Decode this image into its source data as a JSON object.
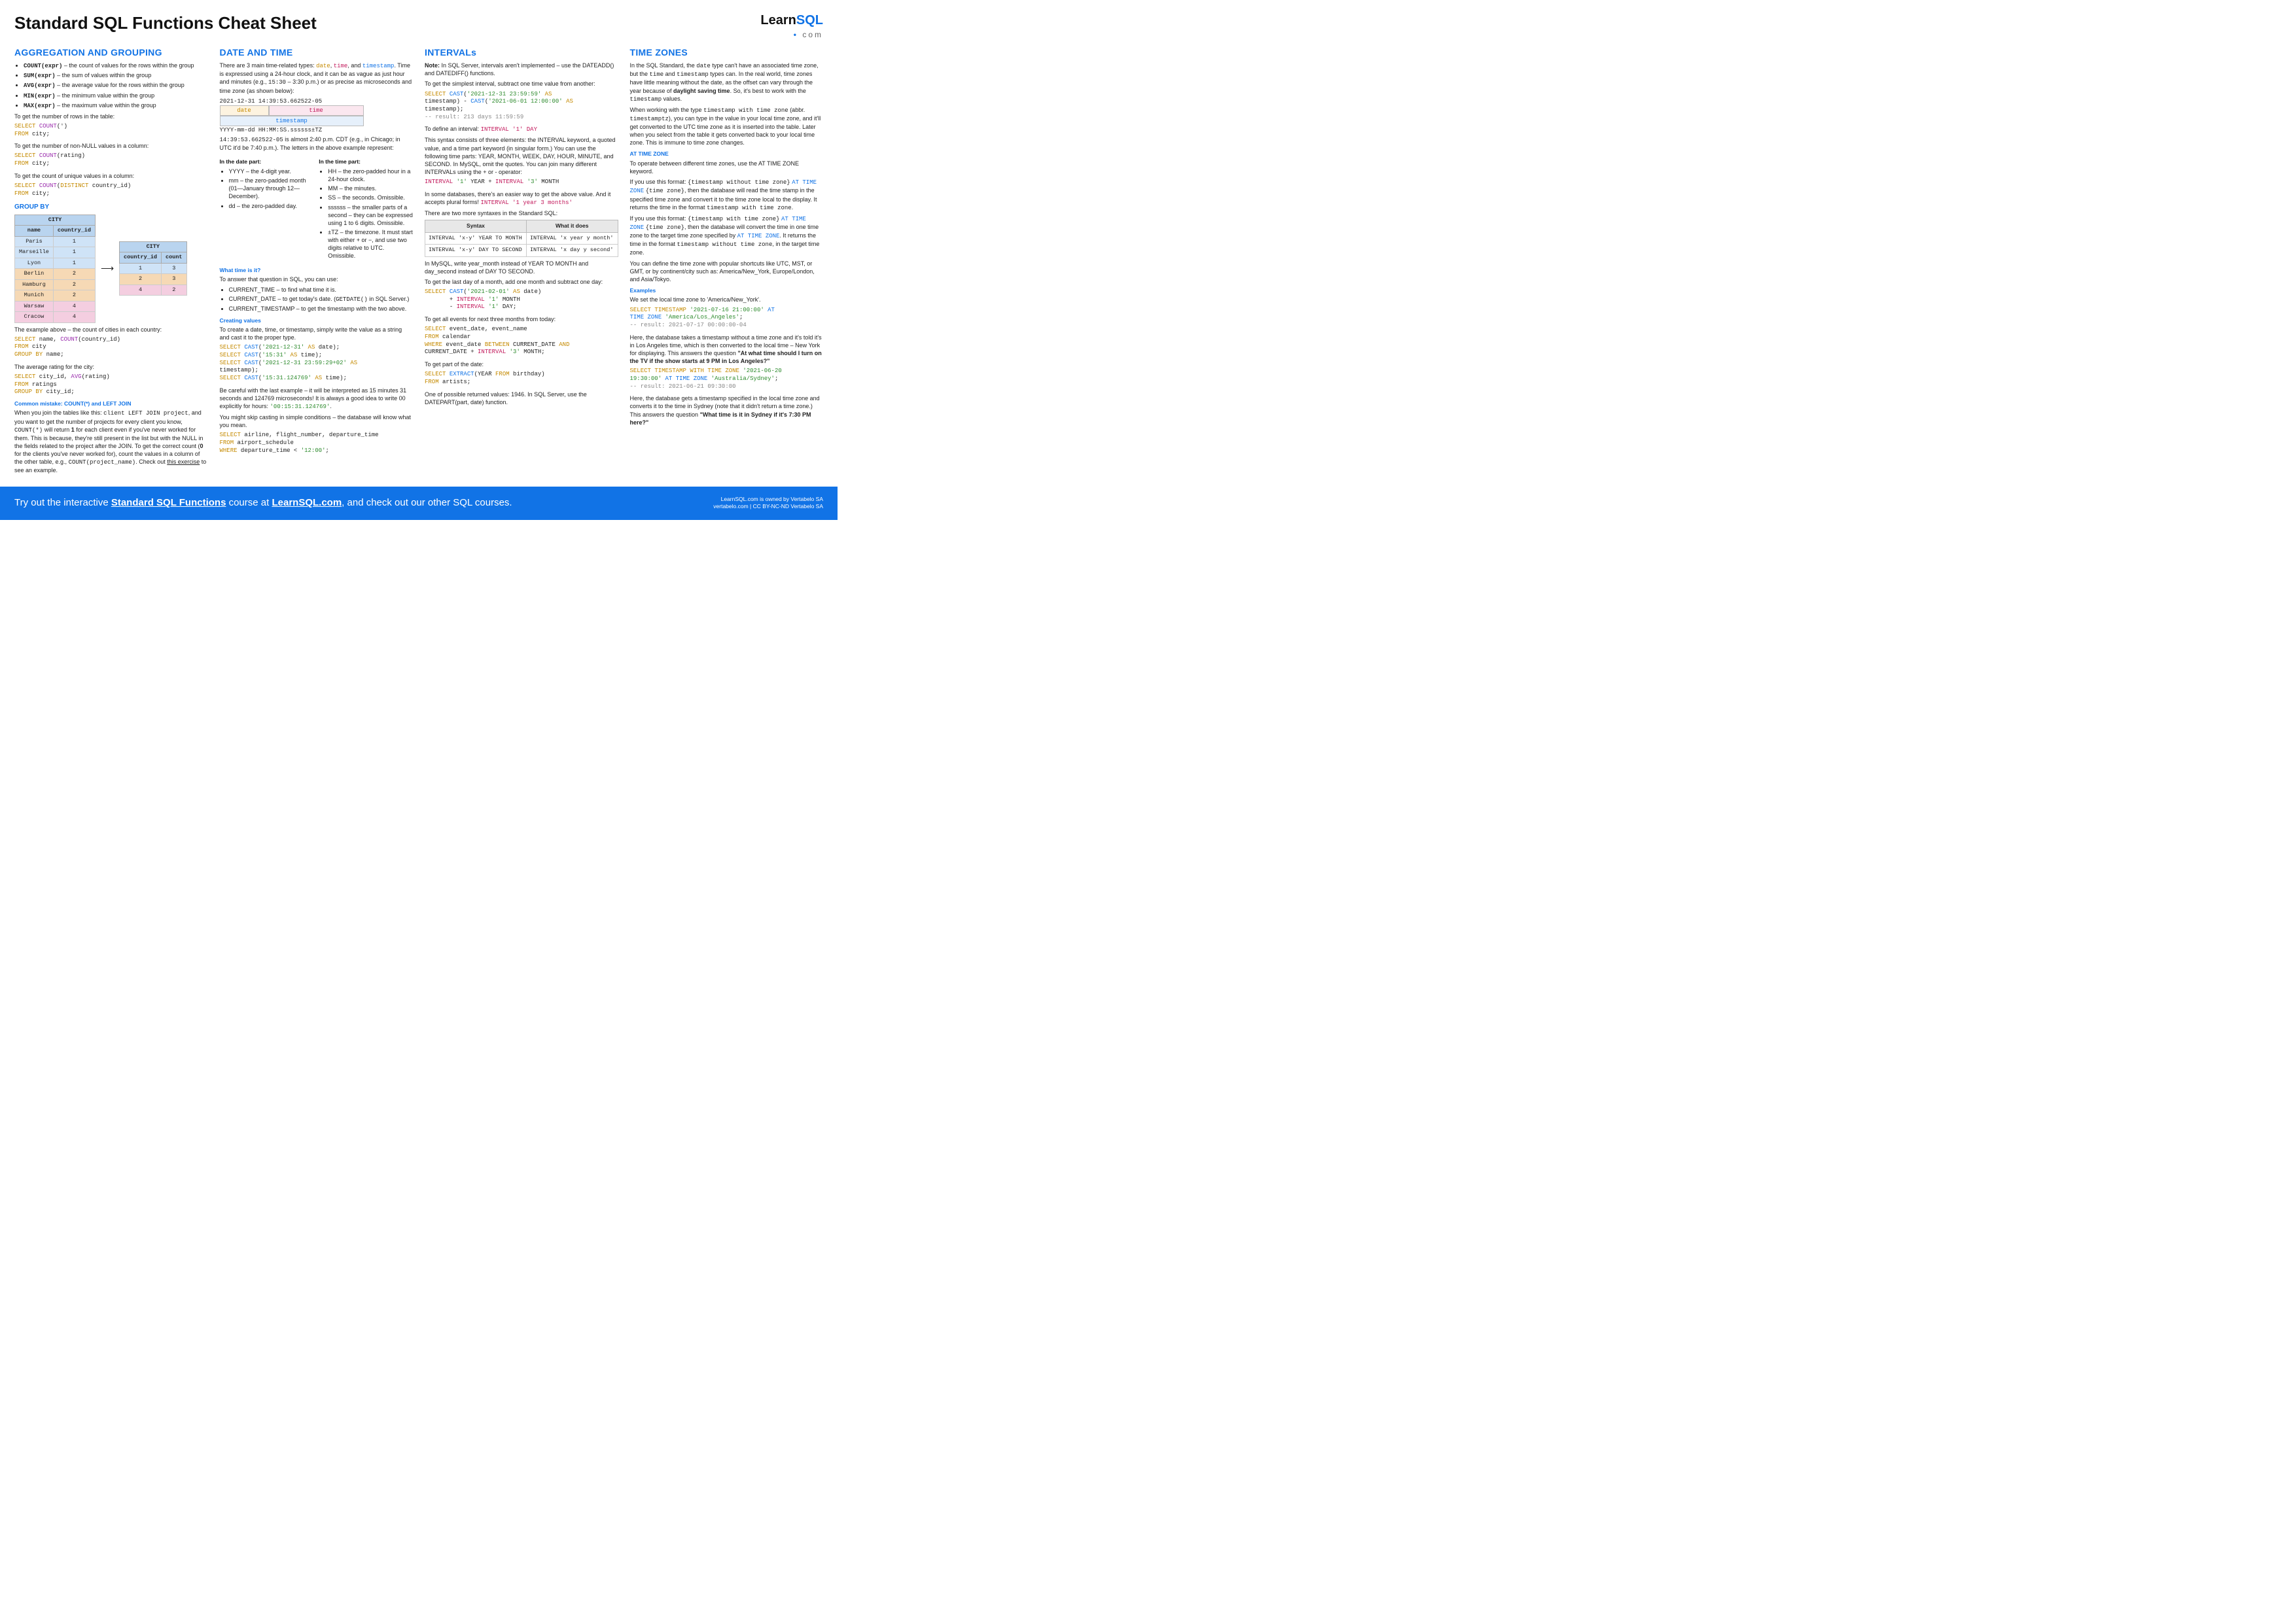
{
  "title": "Standard SQL Functions Cheat Sheet",
  "logo": {
    "learn": "Learn",
    "sql": "SQL",
    "com": "com"
  },
  "col1": {
    "h_agg": "AGGREGATION AND GROUPING",
    "agg_items": {
      "count": "COUNT(expr)",
      "count_d": " – the count of values for the rows within the group",
      "sum": "SUM(expr)",
      "sum_d": " – the sum of values within the group",
      "avg": "AVG(expr)",
      "avg_d": " – the average value for the rows within the group",
      "min": "MIN(expr)",
      "min_d": " – the minimum value within the group",
      "max": "MAX(expr)",
      "max_d": " – the maximum value within the group"
    },
    "p1": "To get the number of rows in the table:",
    "p2": "To get the number of non-NULL values in a column:",
    "p3": "To get the count of unique values in a column:",
    "h_group": "GROUP BY",
    "city_hdr": "CITY",
    "city_cols": {
      "name": "name",
      "cid": "country_id",
      "count": "count"
    },
    "city_rows": [
      {
        "n": "Paris",
        "c": "1"
      },
      {
        "n": "Marseille",
        "c": "1"
      },
      {
        "n": "Lyon",
        "c": "1"
      },
      {
        "n": "Berlin",
        "c": "2"
      },
      {
        "n": "Hamburg",
        "c": "2"
      },
      {
        "n": "Munich",
        "c": "2"
      },
      {
        "n": "Warsaw",
        "c": "4"
      },
      {
        "n": "Cracow",
        "c": "4"
      }
    ],
    "city_agg": [
      {
        "c": "1",
        "k": "3"
      },
      {
        "c": "2",
        "k": "3"
      },
      {
        "c": "4",
        "k": "2"
      }
    ],
    "p4": "The example above – the count of cities in each country:",
    "p5": "The average rating for the city:",
    "h_mistake": "Common mistake: COUNT(*) and LEFT JOIN",
    "mistake_1": "When you join the tables like this: ",
    "mistake_2": ", and you want to get the number of projects for every client you know, ",
    "mistake_3": " will return ",
    "mistake_4": " for each client even if you've never worked for them. This is because, they're still present in the list but with the NULL in the fields related to the project after the JOIN. To get the correct count (",
    "mistake_5": " for the clients you've never worked for), count the values in a column of the other table, e.g., ",
    "mistake_6": ". Check out ",
    "mistake_link": "this exercise",
    "mistake_7": " to see an example."
  },
  "col2": {
    "h_dt": "DATE AND TIME",
    "intro_1": "There are 3 main time-related types: ",
    "intro_2": ". Time is expressed using a 24-hour clock, and it can be as vague as just hour and minutes (e.g., ",
    "intro_3": " – 3:30 p.m.) or as precise as microseconds and time zone (as shown below):",
    "ts_sample": "2021-12-31 14:39:53.662522-05",
    "ts_fmt": "YYYY-mm-dd HH:MM:SS.ssssss±TZ",
    "ts_date_lbl": "date",
    "ts_time_lbl": "time",
    "ts_full_lbl": "timestamp",
    "cdt_1": "14:39:53.662522-05",
    "cdt_2": " is almost 2:40 p.m. CDT (e.g., in Chicago; in UTC it'd be 7:40 p.m.). The letters in the above example represent:",
    "h_datepart": "In the date part:",
    "h_timepart": "In the time part:",
    "dp": {
      "y": "YYYY – the 4-digit year.",
      "m": "mm – the zero-padded month (01—January through 12—December).",
      "d": "dd – the zero-padded day."
    },
    "tp": {
      "h": "HH – the zero-padded hour in a 24-hour clock.",
      "m": "MM – the minutes.",
      "s": "SS – the seconds. Omissible.",
      "ss": "ssssss – the smaller parts of a second – they can be expressed using 1 to 6 digits. Omissible.",
      "tz": "±TZ – the timezone. It must start with either + or −, and use two digits relative to UTC. Omissible."
    },
    "h_what": "What time is it?",
    "what_p": "To answer that question in SQL, you can use:",
    "what_li": {
      "ct": "CURRENT_TIME – to find what time it is.",
      "cd_1": "CURRENT_DATE – to get today's date. (",
      "cd_2": " in SQL Server.)",
      "cts": "CURRENT_TIMESTAMP – to get the timestamp with the two above."
    },
    "h_create": "Creating values",
    "create_p": "To create a date, time, or timestamp, simply write the value as a string and cast it to the proper type.",
    "create_warn_1": "Be careful with the last example – it will be interpreted as 15 minutes 31 seconds and 124769 microseconds! It is always a good idea to write 00 explicitly for hours: ",
    "create_warn_2": ".",
    "skip_p": "You might skip casting in simple conditions – the database will know what you mean."
  },
  "col3": {
    "h_int": "INTERVALs",
    "note": "Note:",
    "note_t": " In SQL Server, intervals aren't implemented – use the DATEADD() and DATEDIFF() functions.",
    "p1": "To get the simplest interval, subtract one time value from another:",
    "res1": "-- result: 213 days 11:59:59",
    "def_1": "To define an interval:  ",
    "def_2": "This syntax consists of three elements: the INTERVAL keyword, a quoted value, and a time part keyword (in singular form.) You can use the following time parts: YEAR, MONTH, WEEK, DAY, HOUR, MINUTE, and SECOND. In MySQL, omit the quotes. You can join many different INTERVALs using the + or - operator:",
    "easy_1": "In some databases, there's an easier way to get the above value. And it accepts plural forms! ",
    "easy_2": "There are two more syntaxes in the Standard SQL:",
    "tbl": {
      "h1": "Syntax",
      "h2": "What it does",
      "r1a": "INTERVAL 'x-y' YEAR TO MONTH",
      "r1b": "INTERVAL 'x year y month'",
      "r2a": "INTERVAL 'x-y' DAY TO SECOND",
      "r2b": "INTERVAL 'x day y second'"
    },
    "mysql_p": "In MySQL, write year_month instead of YEAR TO MONTH and day_second instead of DAY TO SECOND.",
    "last_p": "To get the last day of a month, add one month and subtract one day:",
    "next3_p": "To get all events for next three months from today:",
    "part_p": "To get part of the date:",
    "part_out": "One of possible returned values: 1946. In SQL Server, use the DATEPART(part, date) function."
  },
  "col4": {
    "h_tz": "TIME ZONES",
    "p1_1": "In the SQL Standard, the ",
    "p1_2": " type can't have an associated time zone, but the ",
    "p1_3": " and ",
    "p1_4": " types can. In the real world, time zones have little meaning without the date, as the offset can vary through the year because of ",
    "p1_5": "daylight saving time",
    "p1_6": ". So, it's best to work with the ",
    "p1_7": " values.",
    "p2_1": "When working with the type ",
    "p2_2": " (abbr. ",
    "p2_3": "), you can type in the value in your local time zone, and it'll get converted to the UTC time zone as it is inserted into the table. Later when you select from the table it gets converted back to your local time zone. This is immune to time zone changes.",
    "h_at": "AT TIME ZONE",
    "at_p1": "To operate between different time zones, use the AT TIME ZONE keyword.",
    "at_p2_1": "If you use this format: ",
    "at_p2_2": ", then the database will read the time stamp in the specified time zone and convert it to the time zone local to the display. It returns the time in the format ",
    "at_p2_3": ".",
    "at_p3_1": "If you use this format: ",
    "at_p3_2": ", then the database will convert the time in one time zone to the target time zone specified by ",
    "at_p3_3": ". It returns the time in the format ",
    "at_p3_4": ", in the target time zone.",
    "short_p": "You can define the time zone with popular shortcuts like UTC, MST, or GMT, or by continent/city such as: America/New_York, Europe/London, and Asia/Tokyo.",
    "h_ex": "Examples",
    "ex_p1": "We set the local time zone to 'America/New_York'.",
    "ex_r1": "-- result: 2021-07-17 00:00:00-04",
    "ex_expl1_1": "Here, the database takes a timestamp without a time zone and it's told it's in Los Angeles time, which is then converted to the local time – New York for displaying. This answers the question ",
    "ex_q1": "\"At what time should I turn on the TV if the show starts at 9 PM in Los Angeles?\"",
    "ex_r2": "-- result: 2021-06-21 09:30:00",
    "ex_expl2_1": "Here, the database gets a timestamp specified in the local time zone and converts it to the time in Sydney (note that it didn't return a time zone.) This answers the question ",
    "ex_q2": "\"What time is it in Sydney if it's 7:30 PM here?\""
  },
  "footer": {
    "l1": "Try out the interactive ",
    "link1": "Standard SQL Functions",
    "l2": " course at ",
    "link2": "LearnSQL.com",
    "l3": ", and check out our other SQL courses.",
    "r1": "LearnSQL.com is owned by Vertabelo SA",
    "r2": "vertabelo.com | CC BY-NC-ND Vertabelo SA"
  }
}
